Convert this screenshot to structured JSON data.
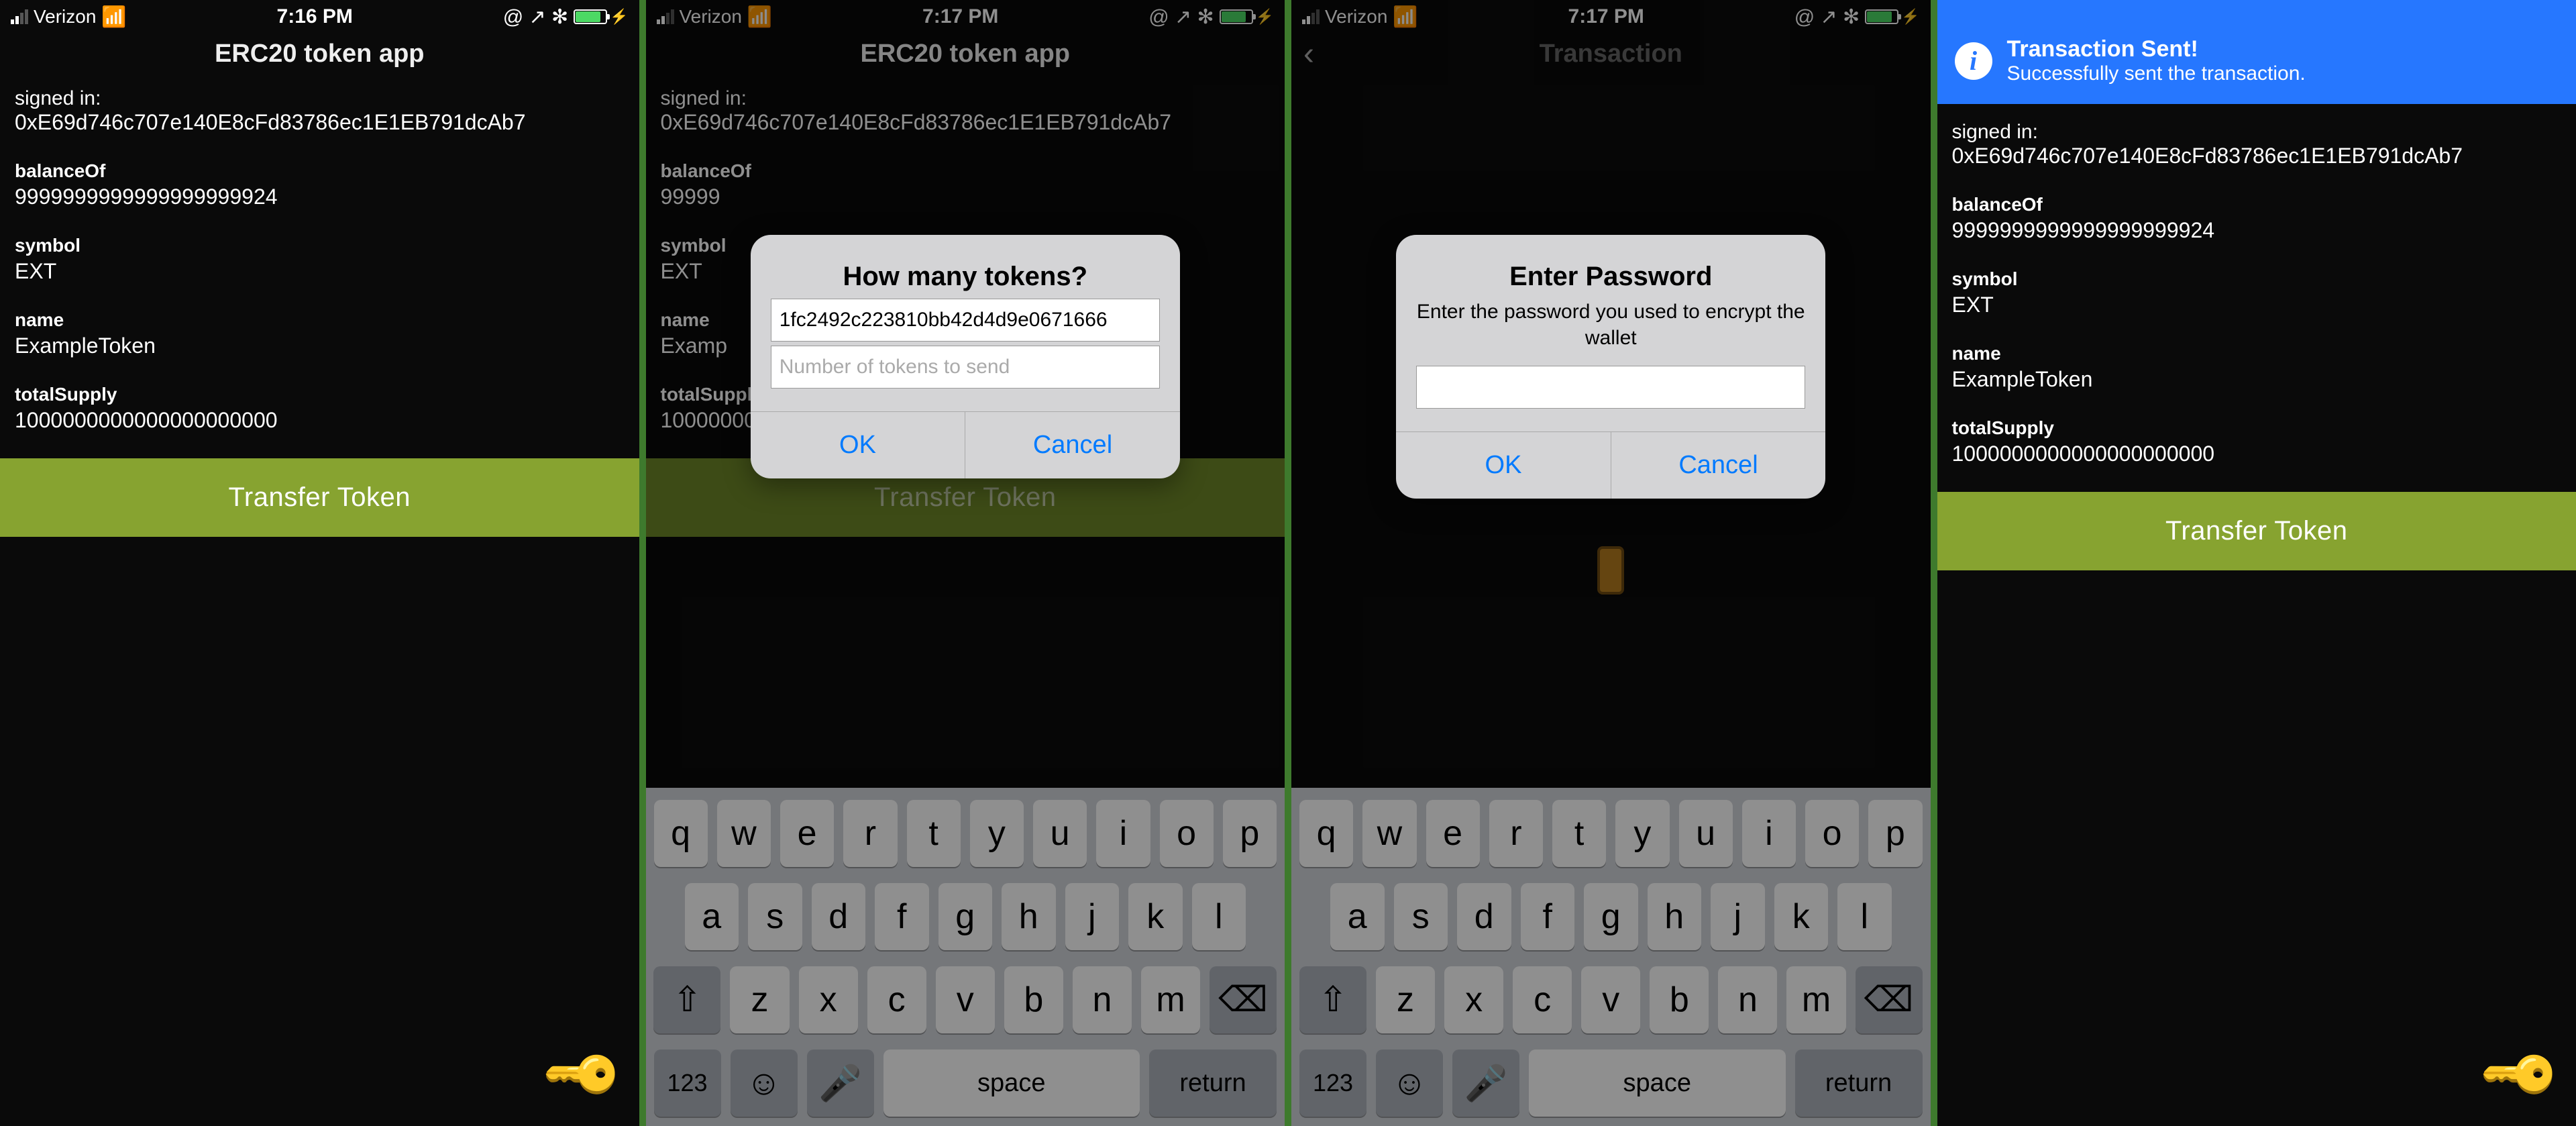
{
  "status": {
    "carrier": "Verizon",
    "wifi_icon": "wifi-icon",
    "times": [
      "7:16 PM",
      "7:17 PM",
      "7:17 PM",
      "7:17 PM"
    ],
    "right_glyphs": "@ ↗ ✻",
    "battery_pct": 80,
    "charging": true
  },
  "app": {
    "title": "ERC20 token app",
    "transaction_title": "Transaction",
    "signed_in_label": "signed in:",
    "address": "0xE69d746c707e140E8cFd83786ec1E1EB791dcAb7",
    "fields": {
      "balanceOf": {
        "label": "balanceOf",
        "value": "9999999999999999999924"
      },
      "balanceOf_truncated": "99999",
      "symbol": {
        "label": "symbol",
        "value": "EXT"
      },
      "name": {
        "label": "name",
        "value": "ExampleToken"
      },
      "name_truncated": "Examp",
      "totalSupply": {
        "label": "totalSupply",
        "value": "1000000000000000000000"
      }
    },
    "transfer_button": "Transfer Token"
  },
  "dialog_tokens": {
    "title": "How many tokens?",
    "input1_value": "1fc2492c223810bb42d4d9e0671666",
    "input2_placeholder": "Number of tokens to send",
    "ok": "OK",
    "cancel": "Cancel"
  },
  "dialog_password": {
    "title": "Enter Password",
    "message": "Enter the password you used to encrypt the wallet",
    "ok": "OK",
    "cancel": "Cancel"
  },
  "banner": {
    "title": "Transaction Sent!",
    "subtitle": "Successfully sent the transaction."
  },
  "keyboard": {
    "row1": [
      "q",
      "w",
      "e",
      "r",
      "t",
      "y",
      "u",
      "i",
      "o",
      "p"
    ],
    "row2": [
      "a",
      "s",
      "d",
      "f",
      "g",
      "h",
      "j",
      "k",
      "l"
    ],
    "row3": [
      "z",
      "x",
      "c",
      "v",
      "b",
      "n",
      "m"
    ],
    "shift": "⇧",
    "backspace": "⌫",
    "numbers": "123",
    "emoji": "☺",
    "mic": "🎤",
    "space": "space",
    "return": "return"
  },
  "icons": {
    "key": "🔑",
    "back": "‹",
    "info": "i"
  }
}
